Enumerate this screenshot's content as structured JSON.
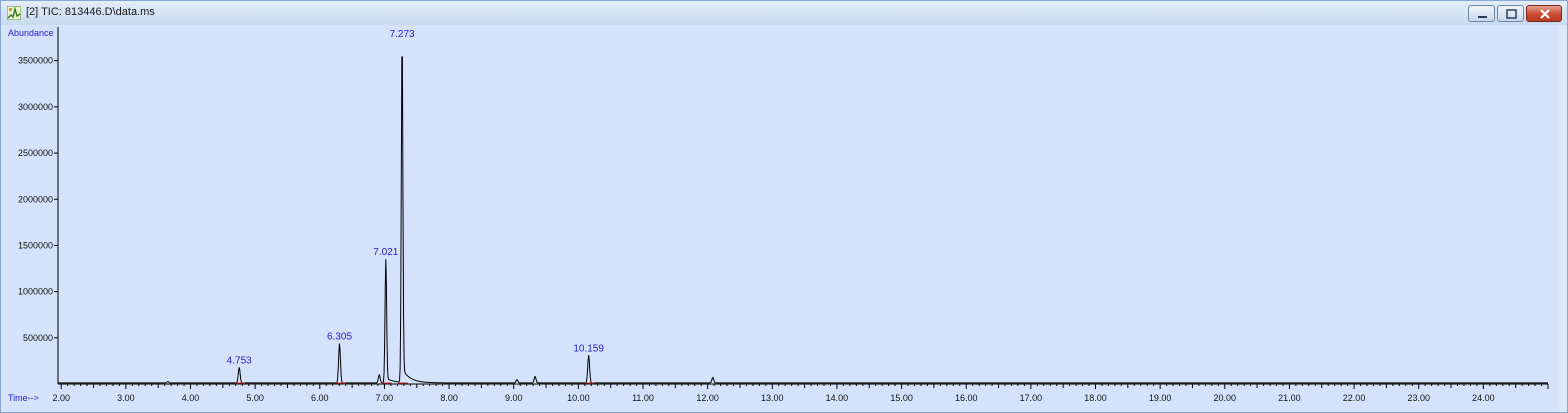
{
  "window": {
    "title": "[2] TIC: 813446.D\\data.ms",
    "icon": "chromatogram-icon",
    "buttons": [
      "minimize-icon",
      "maximize-icon",
      "close-icon"
    ]
  },
  "colors": {
    "plot_bg": "#d4e3fb",
    "trace": "#000000",
    "baseline": "#e03030",
    "label": "#2222cc"
  },
  "chart_data": {
    "type": "line",
    "title": "",
    "ylabel": "Abundance",
    "xlabel": "Time-->",
    "xlim": [
      1.95,
      25.0
    ],
    "ylim": [
      0,
      3800000
    ],
    "x_ticks": [
      2.0,
      3.0,
      4.0,
      5.0,
      6.0,
      7.0,
      8.0,
      9.0,
      10.0,
      11.0,
      12.0,
      13.0,
      14.0,
      15.0,
      16.0,
      17.0,
      18.0,
      19.0,
      20.0,
      21.0,
      22.0,
      23.0,
      24.0
    ],
    "x_tick_labels": [
      "2.00",
      "3.00",
      "4.00",
      "5.00",
      "6.00",
      "7.00",
      "8.00",
      "9.00",
      "10.00",
      "11.00",
      "12.00",
      "13.00",
      "14.00",
      "15.00",
      "16.00",
      "17.00",
      "18.00",
      "19.00",
      "20.00",
      "21.00",
      "22.00",
      "23.00",
      "24.00"
    ],
    "y_ticks": [
      500000,
      1000000,
      1500000,
      2000000,
      2500000,
      3000000,
      3500000
    ],
    "y_tick_labels": [
      "500000",
      "1000000",
      "1500000",
      "2000000",
      "2500000",
      "3000000",
      "3500000"
    ],
    "grid": false,
    "peaks": [
      {
        "rt": 4.753,
        "label": "4.753",
        "height": 170000
      },
      {
        "rt": 6.305,
        "label": "6.305",
        "height": 430000
      },
      {
        "rt": 6.92,
        "label": "",
        "height": 90000
      },
      {
        "rt": 7.021,
        "label": "7.021",
        "height": 1340000
      },
      {
        "rt": 7.273,
        "label": "7.273",
        "height": 3700000
      },
      {
        "rt": 9.05,
        "label": "",
        "height": 35000
      },
      {
        "rt": 9.33,
        "label": "",
        "height": 70000
      },
      {
        "rt": 10.159,
        "label": "10.159",
        "height": 300000
      },
      {
        "rt": 12.08,
        "label": "",
        "height": 60000
      },
      {
        "rt": 3.65,
        "label": "",
        "height": 15000
      }
    ]
  }
}
